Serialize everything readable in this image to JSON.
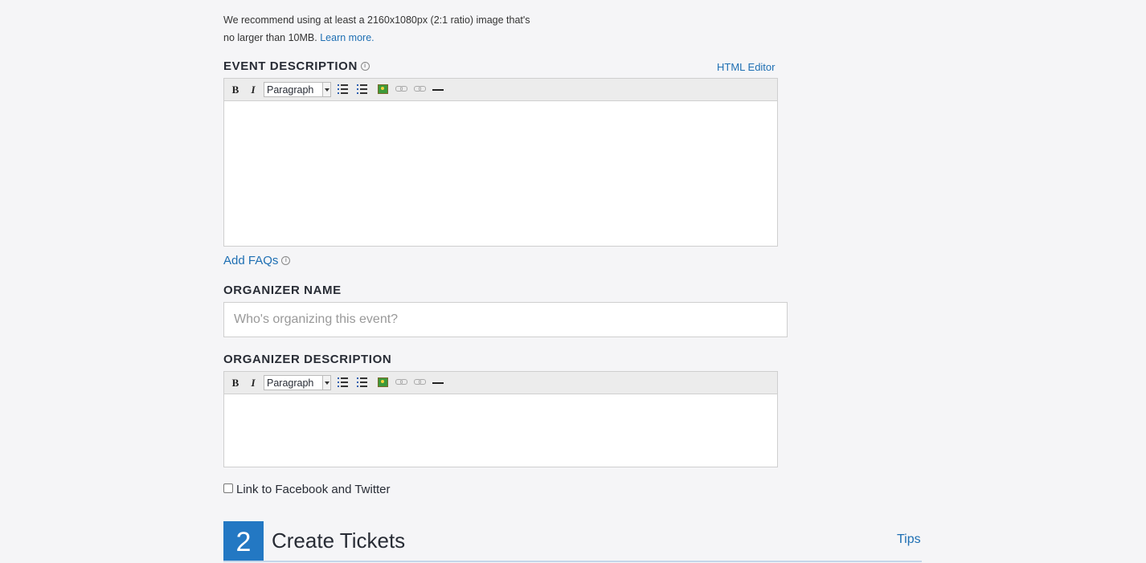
{
  "image_hint": {
    "line1": "We recommend using at least a 2160x1080px (2:1 ratio) image that's",
    "line2": "no larger than 10MB.",
    "learn_more": "Learn more."
  },
  "event_description": {
    "label": "EVENT DESCRIPTION",
    "info_icon": "ⓘ",
    "html_editor_link": "HTML Editor",
    "toolbar": {
      "bold": "B",
      "italic": "I",
      "format_select": "Paragraph",
      "hr": "—"
    },
    "content": ""
  },
  "add_faqs": {
    "label": "Add FAQs",
    "info_icon": "ⓘ"
  },
  "organizer_name": {
    "label": "ORGANIZER NAME",
    "placeholder": "Who's organizing this event?",
    "value": ""
  },
  "organizer_description": {
    "label": "ORGANIZER DESCRIPTION",
    "toolbar": {
      "bold": "B",
      "italic": "I",
      "format_select": "Paragraph",
      "hr": "—"
    },
    "content": ""
  },
  "social_link": {
    "label": "Link to Facebook and Twitter",
    "checked": false
  },
  "section2": {
    "number": "2",
    "title": "Create Tickets",
    "tips_link": "Tips"
  },
  "colors": {
    "accent": "#2378c3",
    "link": "#1e6fb3",
    "background": "#f5f5f7"
  },
  "icons": [
    "info-icon",
    "bold-icon",
    "italic-icon",
    "bullet-list-icon",
    "numbered-list-icon",
    "image-icon",
    "link-icon",
    "unlink-icon",
    "horizontal-rule-icon",
    "dropdown-arrow-icon"
  ]
}
